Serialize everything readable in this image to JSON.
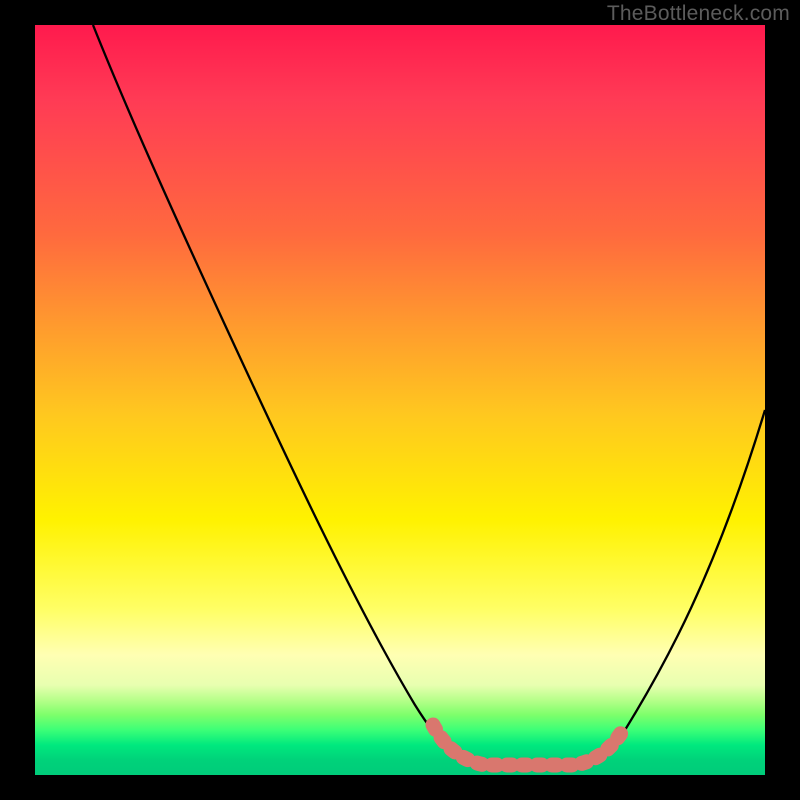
{
  "watermark": "TheBottleneck.com",
  "chart_data": {
    "type": "line",
    "title": "",
    "xlabel": "",
    "ylabel": "",
    "xlim": [
      0,
      100
    ],
    "ylim": [
      0,
      100
    ],
    "grid": false,
    "series": [
      {
        "name": "curve",
        "color": "#000000",
        "x": [
          8,
          12,
          16,
          22,
          28,
          34,
          40,
          46,
          52,
          55,
          57,
          60,
          64,
          68,
          72,
          75,
          78,
          80,
          84,
          88,
          92,
          96,
          100
        ],
        "y": [
          100,
          92,
          84,
          73,
          62,
          50,
          39,
          28,
          16,
          10,
          6,
          3,
          1,
          0.5,
          0.5,
          0.8,
          2,
          4,
          10,
          18,
          28,
          38,
          49
        ]
      },
      {
        "name": "bottom-marker",
        "color": "#d9776e",
        "x": [
          55,
          58,
          62,
          66,
          70,
          74,
          77,
          79,
          80
        ],
        "y": [
          9,
          4,
          1.5,
          0.8,
          0.8,
          1,
          2,
          4,
          6
        ]
      }
    ],
    "annotations": []
  }
}
